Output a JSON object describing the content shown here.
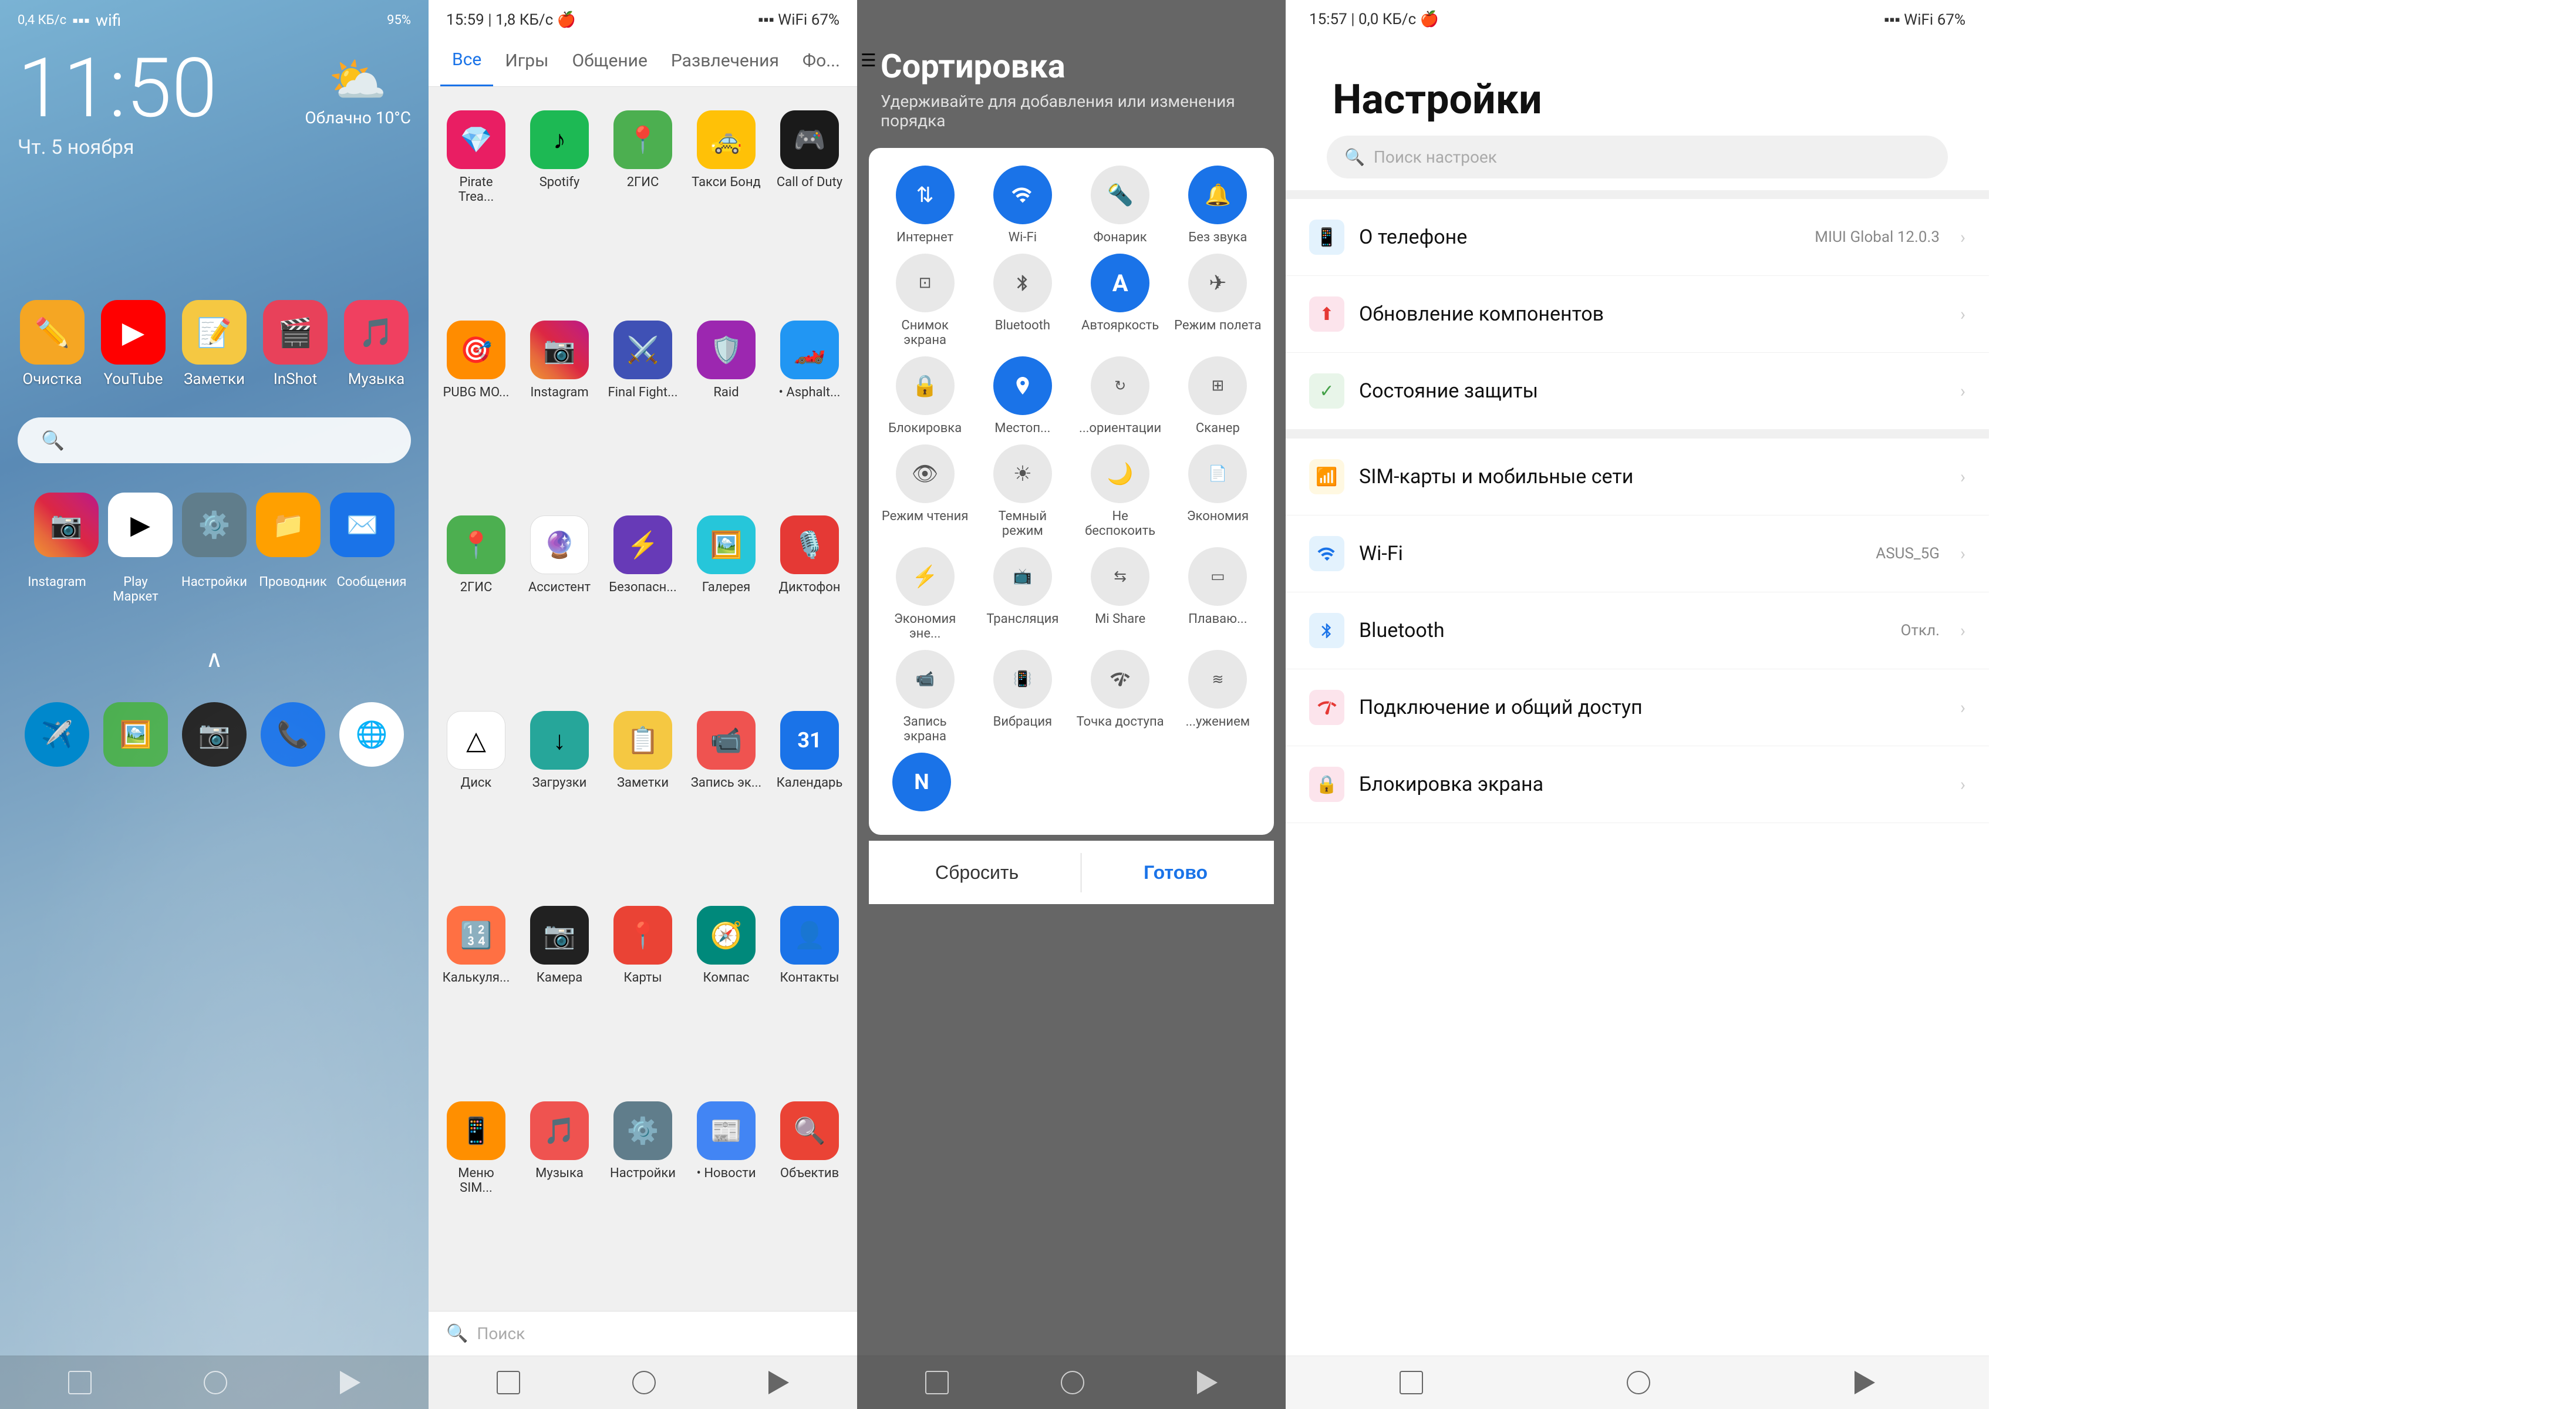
{
  "screen1": {
    "statusbar": {
      "left": "0,4 КБ/с",
      "time": "11:50",
      "date": "Чт. 5 ноября",
      "weather": "Облачно 10°C",
      "weather_icon": "⛅"
    },
    "apps_row1": [
      {
        "name": "Очистка",
        "icon": "✏️",
        "bg": "#f5a623",
        "label": "Очистка"
      },
      {
        "name": "YouTube",
        "icon": "▶",
        "bg": "#ff0000",
        "label": "YouTube"
      },
      {
        "name": "Заметки",
        "icon": "📝",
        "bg": "#f5c842",
        "label": "Заметки"
      },
      {
        "name": "InShot",
        "icon": "🎬",
        "bg": "#e8415a",
        "label": "InShot"
      },
      {
        "name": "Музыка",
        "icon": "🎵",
        "bg": "#f04060",
        "label": "Музыка"
      }
    ],
    "search_placeholder": "",
    "dock": [
      {
        "name": "Instagram",
        "icon": "📷",
        "bg": "linear-gradient(45deg,#f09433,#e6683c,#dc2743,#cc2366,#bc1888)",
        "label": "Instagram"
      },
      {
        "name": "Play Маркет",
        "icon": "▶",
        "bg": "linear-gradient(135deg,#00c853,#1565c0)",
        "label": "Play Маркет"
      },
      {
        "name": "Настройки",
        "icon": "⚙️",
        "bg": "#607d8b",
        "label": "Настройки"
      },
      {
        "name": "Проводник",
        "icon": "📁",
        "bg": "#ffa000",
        "label": "Проводник"
      },
      {
        "name": "Сообщения",
        "icon": "✉️",
        "bg": "#1a73e8",
        "label": "Сообщения"
      }
    ],
    "bottom_dock": [
      {
        "name": "Telegram",
        "icon": "✈️",
        "bg": "#0088cc",
        "label": ""
      },
      {
        "name": "Галерея",
        "icon": "🖼️",
        "bg": "#4caf50",
        "label": ""
      },
      {
        "name": "Камера",
        "icon": "📷",
        "bg": "#212121",
        "label": ""
      },
      {
        "name": "Телефон",
        "icon": "📞",
        "bg": "#1a73e8",
        "label": ""
      },
      {
        "name": "Chrome",
        "icon": "🌐",
        "bg": "white",
        "label": ""
      }
    ]
  },
  "screen2": {
    "statusbar": {
      "time": "15:59",
      "data": "1,8 КБ/с"
    },
    "tabs": [
      {
        "label": "Все",
        "active": true
      },
      {
        "label": "Игры",
        "active": false
      },
      {
        "label": "Общение",
        "active": false
      },
      {
        "label": "Развлечения",
        "active": false
      },
      {
        "label": "Фо...",
        "active": false
      }
    ],
    "apps": [
      {
        "label": "Pirate Trea...",
        "icon": "💎",
        "bg": "#e91e63"
      },
      {
        "label": "Spotify",
        "icon": "♪",
        "bg": "#1db954"
      },
      {
        "label": "2ГИС",
        "icon": "📍",
        "bg": "#4caf50"
      },
      {
        "label": "Такси Бонд",
        "icon": "🚕",
        "bg": "#ffc107"
      },
      {
        "label": "Call of Duty",
        "icon": "🎮",
        "bg": "#1a1a1a"
      },
      {
        "label": "PUBG MO...",
        "icon": "🎯",
        "bg": "#ff8c00"
      },
      {
        "label": "Instagram",
        "icon": "📷",
        "bg": "#e91e63"
      },
      {
        "label": "Final Fight...",
        "icon": "⚔️",
        "bg": "#3f51b5"
      },
      {
        "label": "Raid",
        "icon": "🛡️",
        "bg": "#9c27b0"
      },
      {
        "label": "• Asphalt...",
        "icon": "🏎️",
        "bg": "#2196f3"
      },
      {
        "label": "2ГИС",
        "icon": "📍",
        "bg": "#4caf50"
      },
      {
        "label": "Ассистент",
        "icon": "🔮",
        "bg": "#ea4335"
      },
      {
        "label": "Безопасн...",
        "icon": "⚡",
        "bg": "#673ab7"
      },
      {
        "label": "Галерея",
        "icon": "🖼️",
        "bg": "#26c6da"
      },
      {
        "label": "Диктофон",
        "icon": "🎙️",
        "bg": "#e53935"
      },
      {
        "label": "Диск",
        "icon": "△",
        "bg": "#4caf50"
      },
      {
        "label": "Загрузки",
        "icon": "↓",
        "bg": "#26a69a"
      },
      {
        "label": "Заметки",
        "icon": "📋",
        "bg": "#f5c842"
      },
      {
        "label": "Запись эк...",
        "icon": "📹",
        "bg": "#ef5350"
      },
      {
        "label": "Календарь",
        "icon": "31",
        "bg": "#1a73e8"
      },
      {
        "label": "Калькуля...",
        "icon": "🔢",
        "bg": "#ff7043"
      },
      {
        "label": "Камера",
        "icon": "📷",
        "bg": "#212121"
      },
      {
        "label": "Карты",
        "icon": "📍",
        "bg": "#ea4335"
      },
      {
        "label": "Компас",
        "icon": "🧭",
        "bg": "#00897b"
      },
      {
        "label": "Контакты",
        "icon": "👤",
        "bg": "#1a73e8"
      },
      {
        "label": "Меню SIM...",
        "icon": "📱",
        "bg": "#ff8f00"
      },
      {
        "label": "Музыка",
        "icon": "🎵",
        "bg": "#ef5350"
      },
      {
        "label": "Настройки",
        "icon": "⚙️",
        "bg": "#607d8b"
      },
      {
        "label": "• Новости",
        "icon": "📰",
        "bg": "#4285f4"
      },
      {
        "label": "Объектив",
        "icon": "🔍",
        "bg": "#ea4335"
      }
    ],
    "search_placeholder": "Поиск"
  },
  "screen3": {
    "title": "Сортировка",
    "subtitle": "Удерживайте для добавления или изменения порядка",
    "items": [
      {
        "label": "Интернет",
        "icon": "↑↓",
        "active": true
      },
      {
        "label": "Wi-Fi",
        "icon": "wifi",
        "active": true
      },
      {
        "label": "Фонарик",
        "icon": "🔦",
        "active": false
      },
      {
        "label": "Без звука",
        "icon": "🔔",
        "active": true
      },
      {
        "label": "Снимок экрана",
        "icon": "⊡",
        "active": false
      },
      {
        "label": "Bluetooth",
        "icon": "bluetooth",
        "active": false
      },
      {
        "label": "Автояркость",
        "icon": "A",
        "active": true
      },
      {
        "label": "Режим полета",
        "icon": "✈",
        "active": false
      },
      {
        "label": "Блокировка",
        "icon": "🔒",
        "active": false
      },
      {
        "label": "Местоп...",
        "icon": "location",
        "active": true
      },
      {
        "label": "...ориентации",
        "icon": "rotate",
        "active": false
      },
      {
        "label": "Сканер",
        "icon": "⊞",
        "active": false
      },
      {
        "label": "Режим чтения",
        "icon": "👁",
        "active": false
      },
      {
        "label": "Темный режим",
        "icon": "☀",
        "active": false
      },
      {
        "label": "Не беспокоить",
        "icon": "🌙",
        "active": false
      },
      {
        "label": "Экономия",
        "icon": "📄",
        "active": false
      },
      {
        "label": "Экономия эне...",
        "icon": "⚡",
        "active": false
      },
      {
        "label": "Трансляция",
        "icon": "📺",
        "active": false
      },
      {
        "label": "Mi Share",
        "icon": "share",
        "active": false
      },
      {
        "label": "Плаваю...",
        "icon": "▭",
        "active": false
      },
      {
        "label": "Запись экрана",
        "icon": "📹",
        "active": false
      },
      {
        "label": "Вибрация",
        "icon": "📳",
        "active": false
      },
      {
        "label": "Точка доступа",
        "icon": "wifi-hot",
        "active": false
      },
      {
        "label": "...ужением",
        "icon": "≋",
        "active": false
      },
      {
        "label": "N",
        "icon": "N",
        "active": true,
        "solo": true
      }
    ],
    "reset_label": "Сбросить",
    "done_label": "Готово"
  },
  "screen4": {
    "statusbar": {
      "time": "15:57",
      "data": "0,0 КБ/с"
    },
    "title": "Настройки",
    "search_placeholder": "Поиск настроек",
    "items": [
      {
        "icon": "📱",
        "icon_bg": "#e3f2fd",
        "title": "О телефоне",
        "badge": "MIUI Global 12.0.3",
        "color": "#2196f3"
      },
      {
        "icon": "⬆",
        "icon_bg": "#fce4ec",
        "title": "Обновление компонентов",
        "badge": "",
        "color": "#e53935"
      },
      {
        "icon": "✓",
        "icon_bg": "#e8f5e9",
        "title": "Состояние защиты",
        "badge": "",
        "color": "#43a047"
      },
      {
        "icon": "📶",
        "icon_bg": "#fff8e1",
        "title": "SIM-карты и мобильные сети",
        "badge": "",
        "color": "#ffa000"
      },
      {
        "icon": "wifi",
        "icon_bg": "#e3f2fd",
        "title": "Wi-Fi",
        "badge": "ASUS_5G",
        "color": "#1a73e8"
      },
      {
        "icon": "bluetooth",
        "icon_bg": "#e3f2fd",
        "title": "Bluetooth",
        "badge": "Откл.",
        "color": "#1a73e8"
      },
      {
        "icon": "share",
        "icon_bg": "#fce4ec",
        "title": "Подключение и общий доступ",
        "badge": "",
        "color": "#e53935"
      },
      {
        "icon": "🔒",
        "icon_bg": "#fce4ec",
        "title": "Блокировка экрана",
        "badge": "",
        "color": "#e53935"
      }
    ]
  }
}
